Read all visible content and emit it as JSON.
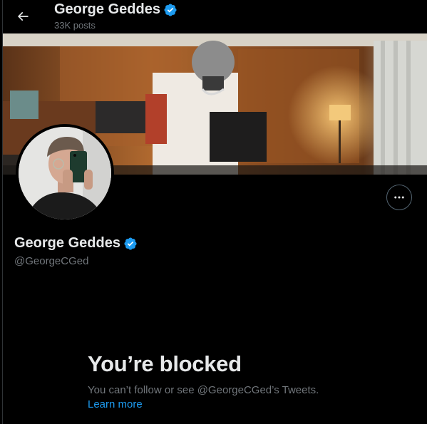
{
  "header": {
    "back_icon": "arrow-left-icon",
    "name": "George Geddes",
    "posts": "33K posts"
  },
  "profile": {
    "name": "George Geddes",
    "handle": "@GeorgeCGed",
    "verified_color": "#1d9bf0",
    "more_icon": "ellipsis-icon"
  },
  "blocked": {
    "title": "You’re blocked",
    "description": "You can’t follow or see @GeorgeCGed’s Tweets.",
    "learn_more": "Learn more"
  },
  "colors": {
    "background": "#000000",
    "text_primary": "#e7e9ea",
    "text_secondary": "#71767b",
    "link": "#1d9bf0"
  }
}
